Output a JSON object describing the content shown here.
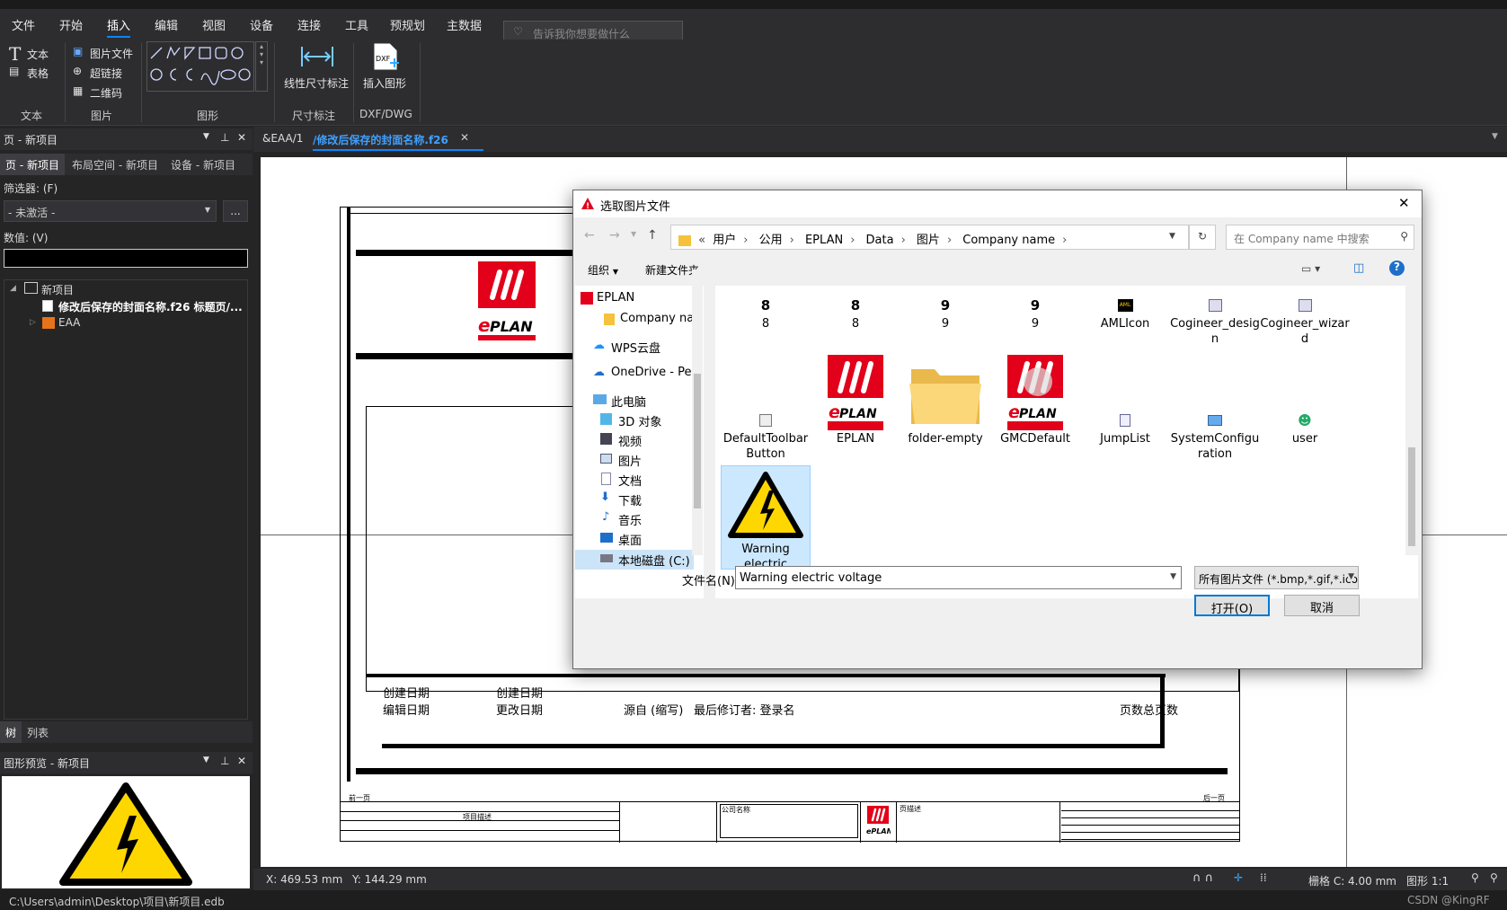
{
  "menu": {
    "items": [
      "文件",
      "开始",
      "插入",
      "编辑",
      "视图",
      "设备",
      "连接",
      "工具",
      "预规划",
      "主数据"
    ],
    "search_placeholder": "告诉我你想要做什么"
  },
  "ribbon": {
    "text": "文本",
    "table": "表格",
    "image_file": "图片文件",
    "hyperlink": "超链接",
    "qrcode": "二维码",
    "linear_dim": "线性尺寸标注",
    "insert_graphic": "插入图形",
    "groups": {
      "text": "文本",
      "image": "图片",
      "graphic": "图形",
      "dimension": "尺寸标注",
      "dxf": "DXF/DWG"
    }
  },
  "left": {
    "pages_title": "页 - 新项目",
    "tabs": [
      "页 - 新项目",
      "布局空间 - 新项目",
      "设备 - 新项目"
    ],
    "filter_label": "筛选器: (F)",
    "filter_value": "- 未激活 -",
    "filter_more": "...",
    "value_label": "数值: (V)",
    "tree_root": "新项目",
    "tree_page": "修改后保存的封面名称.f26 标题页/...",
    "tree_eaa": "EAA",
    "bottom_tabs": [
      "树",
      "列表"
    ],
    "preview_title": "图形预览 - 新项目"
  },
  "doc": {
    "tab1": "&EAA/1",
    "tab2": "/修改后保存的封面名称.f26"
  },
  "cover": {
    "created1": "创建日期",
    "created2": "创建日期",
    "edited1": "编辑日期",
    "changed": "更改日期",
    "source": "源自 (缩写)",
    "lastmod": "最后修订者: 登录名",
    "pages": "页数总页数",
    "prev": "前一页",
    "next": "后一页",
    "company": "公司名称",
    "project_desc": "项目描述",
    "page_desc": "页描述"
  },
  "dialog": {
    "title": "选取图片文件",
    "path": [
      "用户",
      "公用",
      "EPLAN",
      "Data",
      "图片",
      "Company name"
    ],
    "search_placeholder": "在 Company name 中搜索",
    "organize": "组织",
    "new_folder": "新建文件夹",
    "nav": [
      "EPLAN",
      "Company name",
      "WPS云盘",
      "OneDrive - Personal",
      "此电脑",
      "3D 对象",
      "视频",
      "图片",
      "文档",
      "下载",
      "音乐",
      "桌面",
      "本地磁盘 (C:)"
    ],
    "files": [
      {
        "name": "8",
        "icon": "digit-8"
      },
      {
        "name": "8",
        "icon": "digit-8"
      },
      {
        "name": "9",
        "icon": "digit-9"
      },
      {
        "name": "9",
        "icon": "digit-9"
      },
      {
        "name": "AMLIcon",
        "icon": "aml"
      },
      {
        "name": "Cogineer_design",
        "icon": "app"
      },
      {
        "name": "Cogineer_wizard",
        "icon": "app"
      },
      {
        "name": "DefaultToolbarButton",
        "icon": "small"
      },
      {
        "name": "EPLAN",
        "icon": "eplan"
      },
      {
        "name": "folder-empty",
        "icon": "folder"
      },
      {
        "name": "GMCDefault",
        "icon": "eplan-q"
      },
      {
        "name": "JumpList",
        "icon": "small"
      },
      {
        "name": "SystemConfiguration",
        "icon": "monitor"
      },
      {
        "name": "user",
        "icon": "users"
      },
      {
        "name": "Warning electric voltage",
        "icon": "warning"
      }
    ],
    "filename_label": "文件名(N):",
    "filename_value": "Warning electric voltage",
    "filetype": "所有图片文件 (*.bmp,*.gif,*.ico",
    "open": "打开(O)",
    "cancel": "取消"
  },
  "status": {
    "x": "X: 469.53 mm",
    "y": "Y: 144.29 mm",
    "grid": "栅格 C: 4.00 mm",
    "scale": "图形 1:1"
  },
  "bottom": {
    "path": "C:\\Users\\admin\\Desktop\\项目\\新项目.edb",
    "watermark": "CSDN @KingRF"
  },
  "colors": {
    "accent": "#0a84ff",
    "eplan_red": "#e2001a",
    "warning_yellow": "#ffd700"
  }
}
